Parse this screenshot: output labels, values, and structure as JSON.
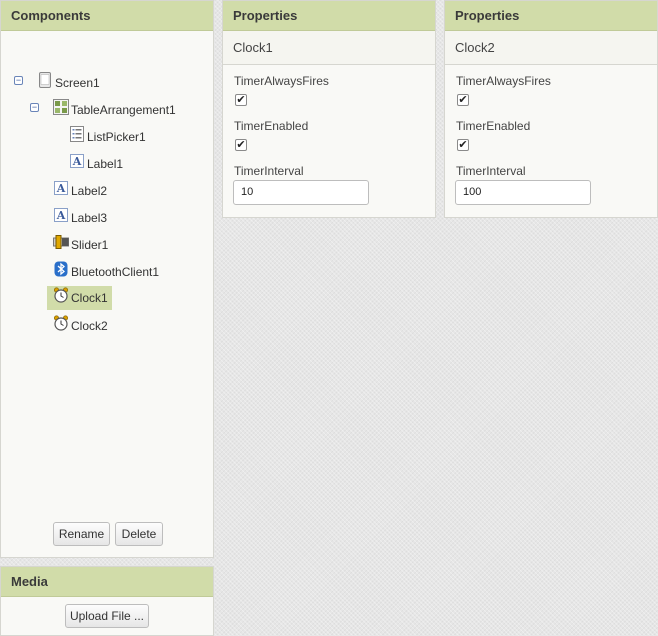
{
  "components_panel": {
    "title": "Components",
    "tree": [
      {
        "label": "Screen1",
        "icon": "screen-icon",
        "expanded": true
      },
      {
        "label": "TableArrangement1",
        "icon": "table-arrangement-icon",
        "expanded": true
      },
      {
        "label": "ListPicker1",
        "icon": "listpicker-icon"
      },
      {
        "label": "Label1",
        "icon": "label-icon"
      },
      {
        "label": "Label2",
        "icon": "label-icon"
      },
      {
        "label": "Label3",
        "icon": "label-icon"
      },
      {
        "label": "Slider1",
        "icon": "slider-icon"
      },
      {
        "label": "BluetoothClient1",
        "icon": "bluetooth-icon"
      },
      {
        "label": "Clock1",
        "icon": "clock-icon",
        "selected": true
      },
      {
        "label": "Clock2",
        "icon": "clock-icon"
      }
    ],
    "rename_label": "Rename",
    "delete_label": "Delete"
  },
  "media_panel": {
    "title": "Media",
    "upload_label": "Upload File ..."
  },
  "properties": [
    {
      "title": "Properties",
      "component": "Clock1",
      "timer_always_fires_label": "TimerAlwaysFires",
      "timer_always_fires": true,
      "timer_enabled_label": "TimerEnabled",
      "timer_enabled": true,
      "timer_interval_label": "TimerInterval",
      "timer_interval": "10"
    },
    {
      "title": "Properties",
      "component": "Clock2",
      "timer_always_fires_label": "TimerAlwaysFires",
      "timer_always_fires": true,
      "timer_enabled_label": "TimerEnabled",
      "timer_enabled": true,
      "timer_interval_label": "TimerInterval",
      "timer_interval": "100"
    }
  ],
  "colors": {
    "header_bg": "#d1dca9",
    "selected_bg": "#d1dca9",
    "panel_bg": "#f9f9f6"
  }
}
